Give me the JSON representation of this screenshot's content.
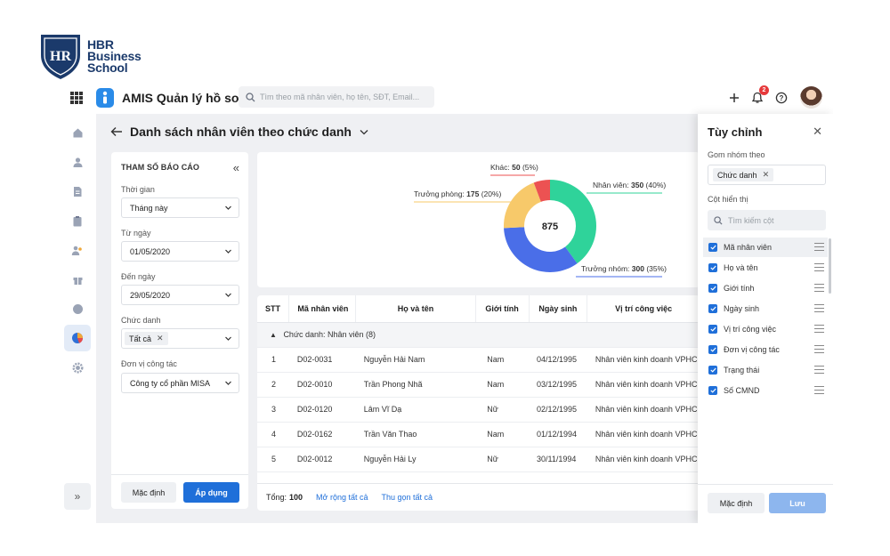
{
  "brand": {
    "line1": "HBR",
    "line2": "Business",
    "line3": "School",
    "color": "#1b3a6b"
  },
  "app": {
    "title": "AMIS Quản lý hồ sơ",
    "search_placeholder": "Tìm theo mã nhân viên, họ tên, SĐT, Email...",
    "notification_count": "2",
    "accent": "#1f6fd9"
  },
  "nav": {
    "icons": [
      "home-icon",
      "user-icon",
      "document-icon",
      "clipboard-icon",
      "team-icon",
      "gift-icon",
      "info-icon",
      "report-icon",
      "settings-icon"
    ],
    "active": "report-icon"
  },
  "page": {
    "title": "Danh sách nhân viên theo chức danh"
  },
  "params": {
    "title": "THAM SỐ BÁO CÁO",
    "time_label": "Thời gian",
    "time_value": "Tháng này",
    "from_label": "Từ ngày",
    "from_value": "01/05/2020",
    "to_label": "Đến ngày",
    "to_value": "29/05/2020",
    "title_label": "Chức danh",
    "title_chip": "Tất cả",
    "unit_label": "Đơn vị công tác",
    "unit_value": "Công ty cổ phần MISA",
    "default_button": "Mặc định",
    "apply_button": "Áp dụng"
  },
  "chart_data": {
    "type": "pie",
    "total": "875",
    "slices": [
      {
        "label": "Nhân viên",
        "count": "350",
        "percent": "(40%)",
        "value": 350,
        "color": "#2fd39a"
      },
      {
        "label": "Trưởng nhóm",
        "count": "300",
        "percent": "(35%)",
        "value": 300,
        "color": "#4a6ee8"
      },
      {
        "label": "Trưởng phòng",
        "count": "175",
        "percent": "(20%)",
        "value": 175,
        "color": "#f7c96a"
      },
      {
        "label": "Khác",
        "count": "50",
        "percent": "(5%)",
        "value": 50,
        "color": "#ec5252"
      }
    ]
  },
  "table": {
    "headers": [
      "STT",
      "Mã nhân viên",
      "Họ và tên",
      "Giới tính",
      "Ngày sinh",
      "Vị trí công việc"
    ],
    "group_label": "Chức danh: Nhân viên (8)",
    "rows": [
      [
        "1",
        "D02-0031",
        "Nguyễn Hải Nam",
        "Nam",
        "04/12/1995",
        "Nhân viên kinh doanh VPHCI"
      ],
      [
        "2",
        "D02-0010",
        "Trần Phong Nhã",
        "Nam",
        "03/12/1995",
        "Nhân viên kinh doanh VPHCI"
      ],
      [
        "3",
        "D02-0120",
        "Lâm Vĩ Dạ",
        "Nữ",
        "02/12/1995",
        "Nhân viên kinh doanh VPHCI"
      ],
      [
        "4",
        "D02-0162",
        "Trần Văn Thao",
        "Nam",
        "01/12/1994",
        "Nhân viên kinh doanh VPHCI"
      ],
      [
        "5",
        "D02-0012",
        "Nguyễn Hải Ly",
        "Nữ",
        "30/11/1994",
        "Nhân viên kinh doanh VPHCI"
      ]
    ],
    "total_label": "Tổng:",
    "total_value": "100",
    "expand_all": "Mở rộng tất cả",
    "collapse_all": "Thu gọn tất cả"
  },
  "custom": {
    "title": "Tùy chỉnh",
    "group_label": "Gom nhóm theo",
    "group_chip": "Chức danh",
    "columns_label": "Cột hiển thị",
    "search_placeholder": "Tìm kiếm cột",
    "columns": [
      "Mã nhân viên",
      "Họ và tên",
      "Giới tính",
      "Ngày sinh",
      "Vị trí công việc",
      "Đơn vị công tác",
      "Trạng thái",
      "Số CMND"
    ],
    "default_button": "Mặc định",
    "save_button": "Lưu"
  }
}
